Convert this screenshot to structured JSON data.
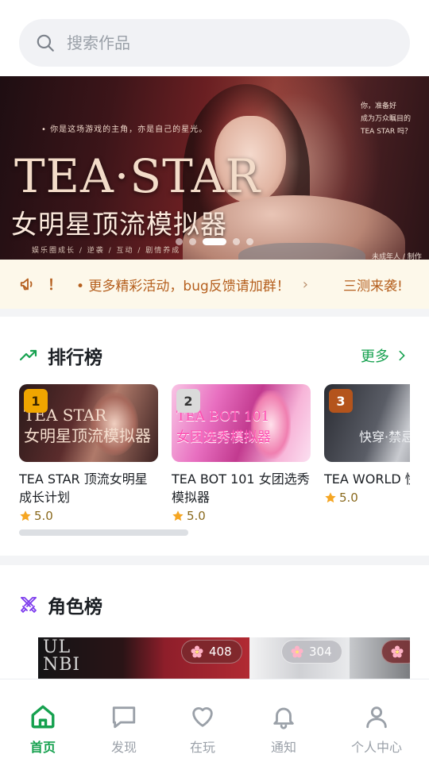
{
  "search": {
    "placeholder": "搜索作品"
  },
  "banner": {
    "title_en": "TEA·STAR",
    "title_cn": "女明星顶流模拟器",
    "tagline": "• 你是这场游戏的主角，亦是自己的星光。",
    "subline": "娱乐圈成长 / 逆袭 / 互动 / 剧情养成",
    "corner_text": [
      "你，准备好",
      "成为万众瞩目的",
      "TEA STAR 吗？"
    ],
    "corner_badge": "未成年人 / 制作",
    "slide_count": 5,
    "active_slide": 3
  },
  "notice": {
    "bang": "！",
    "message": "• 更多精彩活动，bug反馈请加群！",
    "next_message": "三测来袭!"
  },
  "ranking": {
    "title": "排行榜",
    "more_label": "更多",
    "cards": [
      {
        "rank": "1",
        "badge_color": "#f0a500",
        "cover_text": "TEA STAR\n女明星顶流模拟器",
        "name": "TEA STAR 顶流女明星成长计划",
        "rating": "5.0"
      },
      {
        "rank": "2",
        "badge_color": "#dadada",
        "cover_text": "TEA BOT 101\n女团选秀模拟器",
        "name": "TEA BOT 101 女团选秀模拟器",
        "rating": "5.0"
      },
      {
        "rank": "3",
        "badge_color": "#b4541c",
        "cover_text": "快穿·禁忌",
        "name": "TEA WORLD 快穿禁忌攻略",
        "rating": "5.0"
      }
    ]
  },
  "roles": {
    "title": "角色榜",
    "cover_text": "UL\nNBI",
    "heat": [
      "408",
      "304",
      ""
    ]
  },
  "tabbar": {
    "items": [
      {
        "label": "首页",
        "icon": "home-icon",
        "active": true
      },
      {
        "label": "发现",
        "icon": "chat-bubble-icon",
        "active": false
      },
      {
        "label": "在玩",
        "icon": "heart-icon",
        "active": false
      },
      {
        "label": "通知",
        "icon": "bell-icon",
        "active": false
      },
      {
        "label": "个人中心",
        "icon": "user-icon",
        "active": false
      }
    ]
  },
  "colors": {
    "accent": "#16a14f",
    "notice_text": "#b55f1e",
    "notice_bg": "#fdf8ea",
    "rating_star": "#f5a623",
    "rank_icon": "#7c3aed"
  }
}
